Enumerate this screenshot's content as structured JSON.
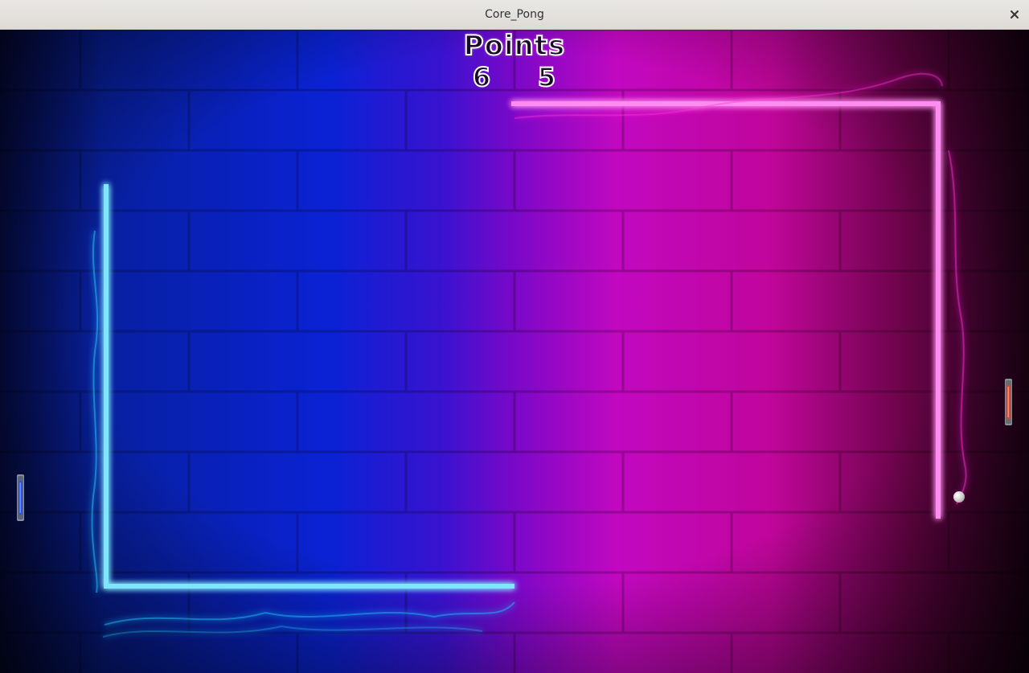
{
  "window": {
    "title": "Core_Pong",
    "close_icon": "close-icon"
  },
  "scoreboard": {
    "title": "Points",
    "left_score": "6",
    "right_score": "5"
  },
  "colors": {
    "left_neon": "#27c6ff",
    "right_neon": "#ff2fd6",
    "left_paddle": "#2a52d8",
    "right_paddle": "#ff3b1f",
    "ball": "#d9d9d9"
  }
}
